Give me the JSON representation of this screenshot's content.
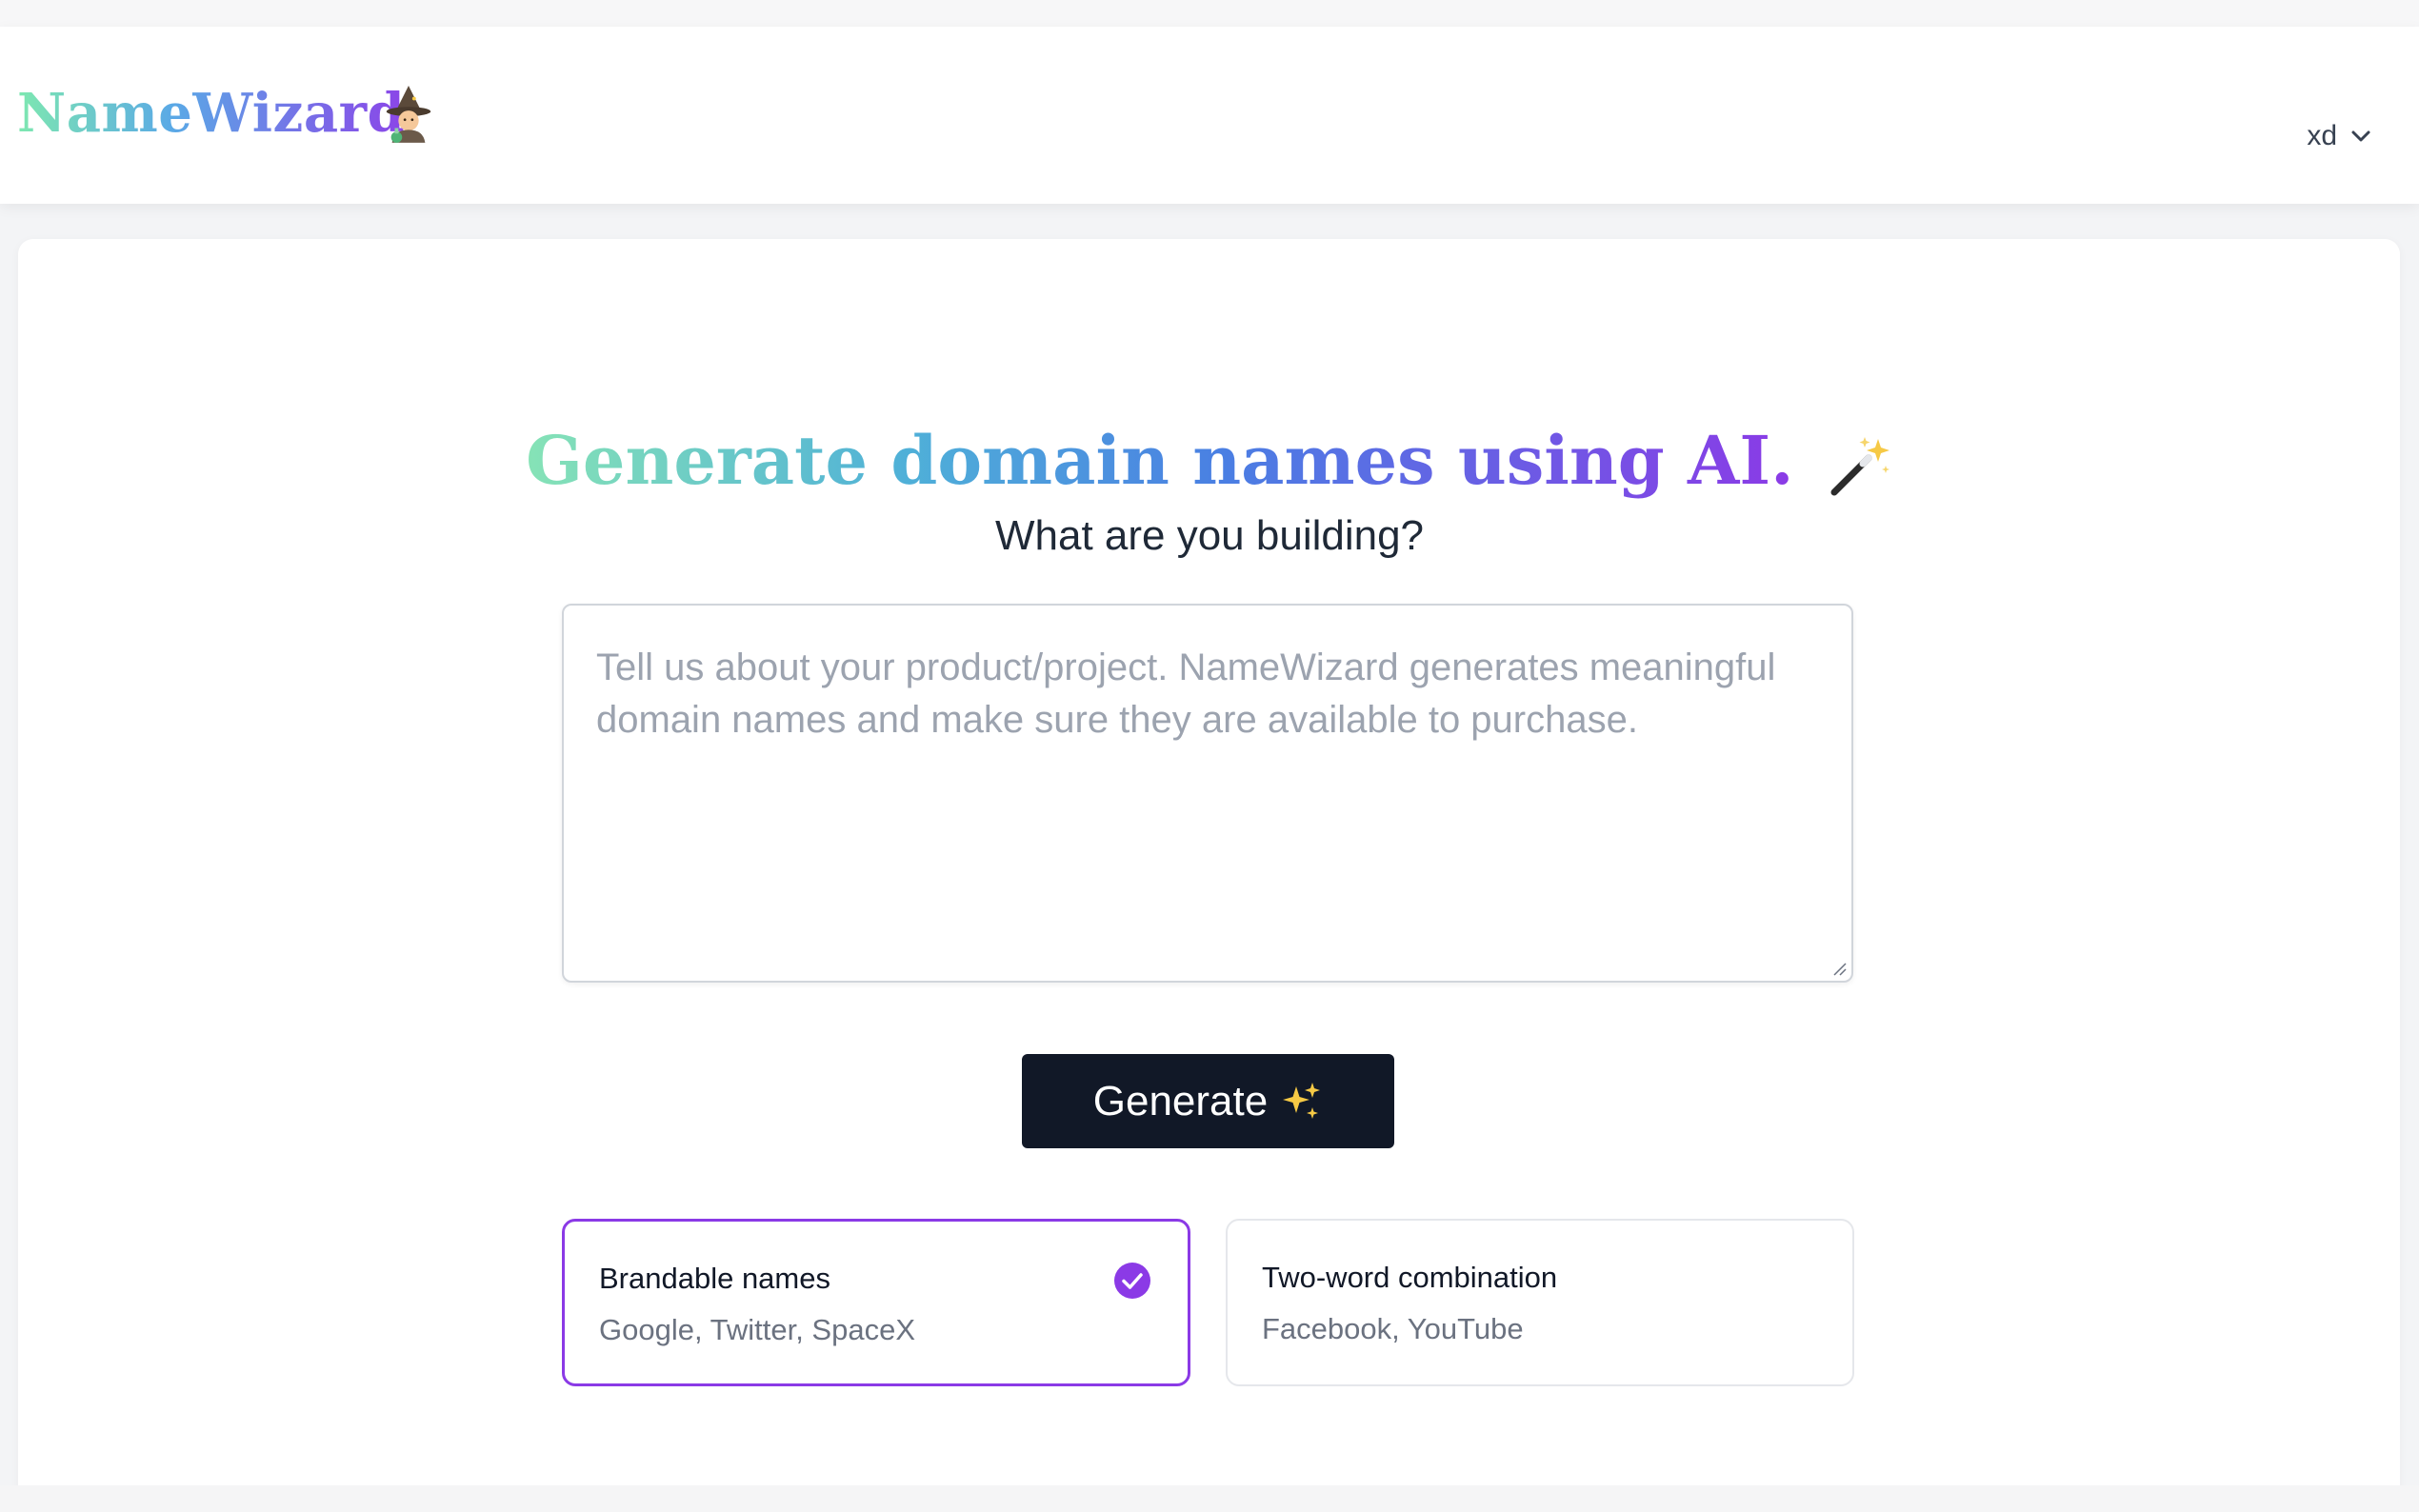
{
  "brand": {
    "name": "NameWizard",
    "emoji_icon": "wizard-emoji"
  },
  "user_menu": {
    "label": "xd",
    "icon": "chevron-down-icon"
  },
  "hero": {
    "title": "Generate domain names using AI.",
    "title_icon": "magic-wand-emoji",
    "subtitle": "What are you building?"
  },
  "prompt": {
    "placeholder": "Tell us about your product/project. NameWizard generates meaningful domain names and make sure they are available to purchase.",
    "value": ""
  },
  "generate_button": {
    "label": "Generate",
    "icon": "sparkles-emoji"
  },
  "options": [
    {
      "title": "Brandable names",
      "examples": "Google, Twitter, SpaceX",
      "selected": true
    },
    {
      "title": "Two-word combination",
      "examples": "Facebook, YouTube",
      "selected": false
    }
  ],
  "colors": {
    "accent": "#8b3ae6",
    "button_bg": "#111827",
    "gradient_start": "#7ee8b0",
    "gradient_mid": "#4a7fe3",
    "gradient_end": "#8b3ae6"
  }
}
